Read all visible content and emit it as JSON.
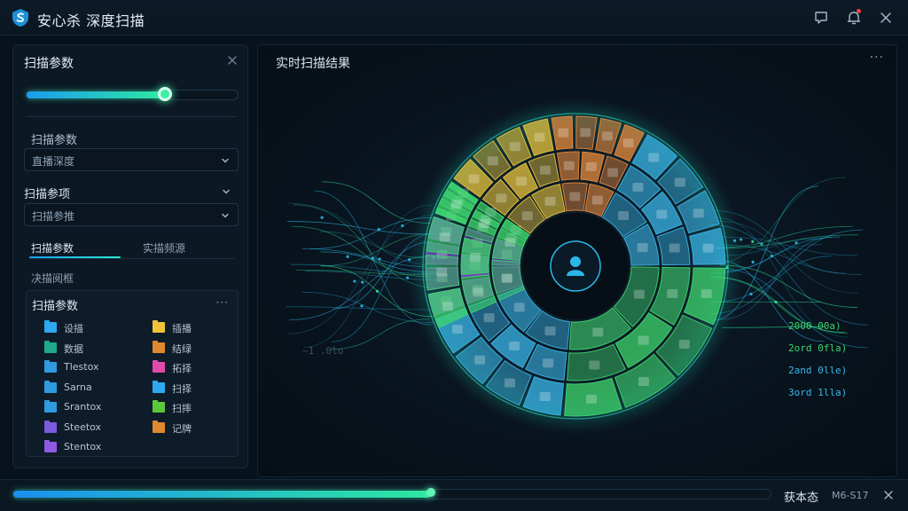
{
  "app": {
    "title": "安心杀 深度扫描",
    "logo_icon": "shield-s-logo"
  },
  "titlebar": {
    "icons": [
      "chat-icon",
      "bell-icon",
      "close-icon"
    ]
  },
  "left_panel": {
    "header": "扫描参数",
    "slider_value": 0.65,
    "field1_label": "扫描参数",
    "field1_select_value": "直播深度",
    "field2_label": "扫描参项",
    "field2_select_value": "扫描参推",
    "tabs": [
      "扫描参数",
      "实描频源"
    ],
    "active_tab": 0,
    "section_label": "决描阅框",
    "files_title": "扫描参数",
    "files_more": "···",
    "files_left": [
      {
        "name": "设描",
        "color": "#2ea8f0"
      },
      {
        "name": "数据",
        "color": "#1fa88a"
      },
      {
        "name": "Tlestox",
        "color": "#2e9be0"
      },
      {
        "name": "Sarna",
        "color": "#2e9be0"
      },
      {
        "name": "Srantox",
        "color": "#2e9be0"
      },
      {
        "name": "Steetox",
        "color": "#7b5ae0"
      },
      {
        "name": "Stentox",
        "color": "#8e5ae0"
      }
    ],
    "files_right": [
      {
        "name": "插播",
        "color": "#f0c23a"
      },
      {
        "name": "结绿",
        "color": "#e0882e"
      },
      {
        "name": "拓择",
        "color": "#e04aa8"
      },
      {
        "name": "扫择",
        "color": "#2ea8f0"
      },
      {
        "name": "扫摔",
        "color": "#5ac83a"
      },
      {
        "name": "记牌",
        "color": "#e0882e"
      }
    ]
  },
  "main_panel": {
    "title": "实时扫描结果",
    "more": "···",
    "center_icon": "user-icon",
    "faint_label": "~1 .0lo",
    "ring_colors": [
      "#3fd56e",
      "#e8c43c",
      "#e88a3c",
      "#3ab6e8",
      "#3fd56e",
      "#3ab6e8",
      "#8a5ae0"
    ],
    "legend": [
      {
        "text": "2000 00a)",
        "color": "#3fd56e"
      },
      {
        "text": "2ord 0fla)",
        "color": "#3fd56e"
      },
      {
        "text": "2and 0lle)",
        "color": "#3ab6e8"
      },
      {
        "text": "3ord 1lla)",
        "color": "#3ab6e8"
      }
    ]
  },
  "bottom_bar": {
    "progress": 0.55,
    "status_text": "获本态",
    "status_code": "M6-S17"
  }
}
